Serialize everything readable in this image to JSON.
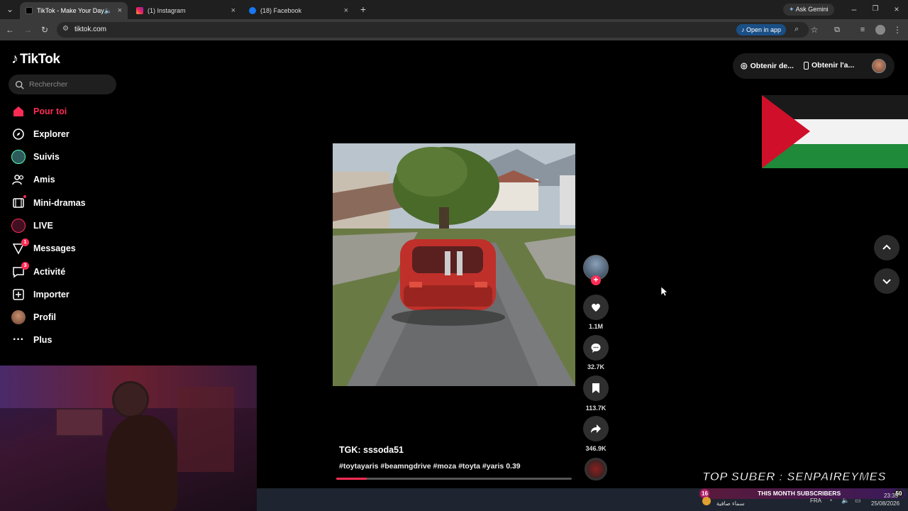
{
  "browser": {
    "tabs": [
      {
        "title": "TikTok - Make Your Day",
        "active": true
      },
      {
        "title": "(1) Instagram",
        "active": false
      },
      {
        "title": "(18) Facebook",
        "active": false
      }
    ],
    "ask_gemini": "Ask Gemini",
    "url": "tiktok.com",
    "open_in_app": "Open in app"
  },
  "sidebar": {
    "logo": "TikTok",
    "search_placeholder": "Rechercher",
    "items": [
      {
        "label": "Pour toi",
        "icon": "home-icon",
        "active": true
      },
      {
        "label": "Explorer",
        "icon": "compass-icon"
      },
      {
        "label": "Suivis",
        "icon": "following-icon"
      },
      {
        "label": "Amis",
        "icon": "friends-icon"
      },
      {
        "label": "Mini-dramas",
        "icon": "film-icon"
      },
      {
        "label": "LIVE",
        "icon": "live-icon"
      },
      {
        "label": "Messages",
        "icon": "messages-icon",
        "badge": "1"
      },
      {
        "label": "Activité",
        "icon": "activity-icon",
        "badge": "3"
      },
      {
        "label": "Importer",
        "icon": "upload-icon"
      },
      {
        "label": "Profil",
        "icon": "profile-icon"
      },
      {
        "label": "Plus",
        "icon": "more-icon"
      }
    ]
  },
  "topright": {
    "coins_label": "Obtenir de...",
    "app_label": "Obtenir l'a..."
  },
  "video": {
    "author": "TGK: sssoda51",
    "caption": "#toytayaris #beamngdrive #moza #toyta #yaris 0.39",
    "progress": 0.13,
    "likes": "1.1M",
    "comments": "32.7K",
    "saves": "113.7K",
    "shares": "346.9K"
  },
  "overlay": {
    "top_suber": "TOP SUBER : SENPAIREYMES",
    "sub_count_left": "16",
    "sub_label": "THIS MONTH SUBSCRIBERS",
    "sub_count_right": "50",
    "weather": "سماء صافية",
    "lang": "FRA",
    "time": "23:35",
    "date": "25/08/2026"
  },
  "colors": {
    "accent": "#fe2c55",
    "background": "#000000"
  }
}
